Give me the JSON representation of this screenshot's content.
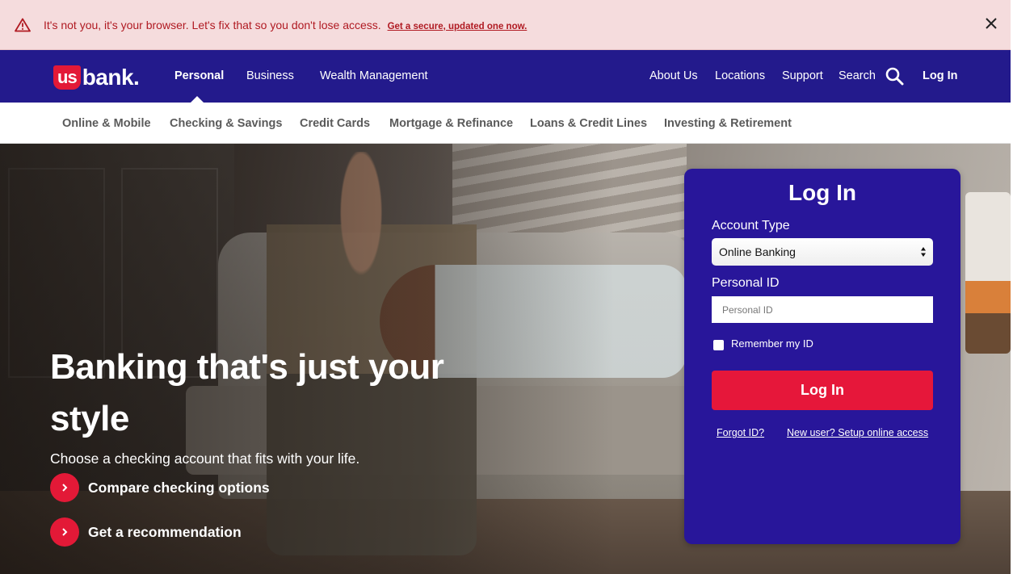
{
  "alert": {
    "icon": "warning-triangle-icon",
    "message": "It's not you, it's your browser. Let's fix that so you don't lose access.",
    "link_label": "Get a secure, updated one now.",
    "close_icon": "close-icon",
    "color": "#b01a22",
    "background": "#f5dcdd"
  },
  "header": {
    "logo": {
      "us": "us",
      "bank": "bank",
      "dot": "."
    },
    "primary_nav": [
      {
        "label": "Personal",
        "active": true
      },
      {
        "label": "Business"
      },
      {
        "label": "Wealth Management"
      }
    ],
    "utility_nav": [
      {
        "label": "About Us"
      },
      {
        "label": "Locations"
      },
      {
        "label": "Support"
      },
      {
        "label": "Search",
        "icon": "search-icon"
      },
      {
        "label": "Log In"
      }
    ],
    "background": "#231a8c"
  },
  "subnav": {
    "items": [
      {
        "label": "Online & Mobile"
      },
      {
        "label": "Checking & Savings"
      },
      {
        "label": "Credit Cards"
      },
      {
        "label": "Mortgage & Refinance"
      },
      {
        "label": "Loans & Credit Lines"
      },
      {
        "label": "Investing & Retirement"
      }
    ]
  },
  "hero": {
    "title": "Banking that's just your style",
    "subtitle": "Choose a checking account that fits with your life.",
    "ctas": [
      {
        "label": "Compare checking options",
        "icon": "chevron-right-icon"
      },
      {
        "label": "Get a recommendation",
        "icon": "chevron-right-icon"
      }
    ],
    "accent": "#e31937"
  },
  "login": {
    "title": "Log In",
    "account_type_label": "Account Type",
    "account_type_value": "Online Banking",
    "personal_id_label": "Personal ID",
    "personal_id_placeholder": "Personal ID",
    "personal_id_value": "",
    "remember_label": "Remember my ID",
    "remember_checked": false,
    "button_label": "Log In",
    "forgot_id": "Forgot ID?",
    "new_user": "New user? Setup online access",
    "background": "#28169a",
    "button_color": "#e6173a"
  }
}
